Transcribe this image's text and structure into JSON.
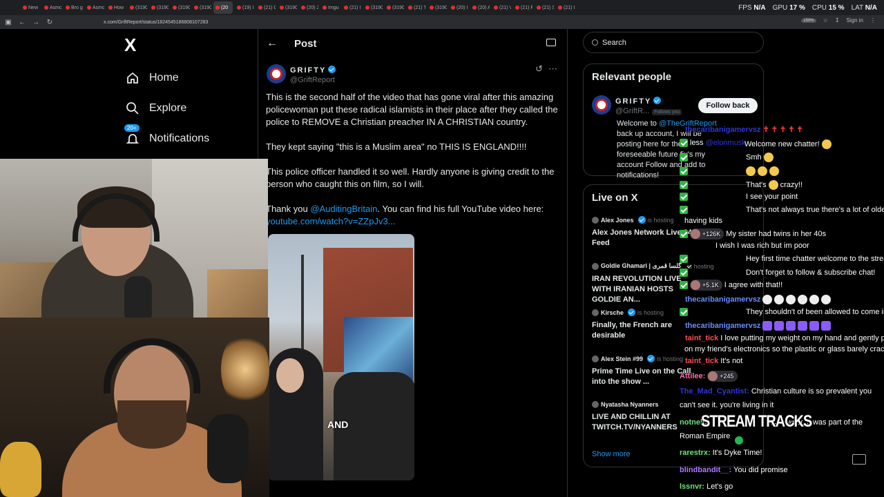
{
  "browser": {
    "tabs": [
      {
        "label": "New"
      },
      {
        "label": "Asmo"
      },
      {
        "label": "Bro g"
      },
      {
        "label": "Asmo"
      },
      {
        "label": "How"
      },
      {
        "label": "(3190"
      },
      {
        "label": "(3190"
      },
      {
        "label": "(3190"
      },
      {
        "label": "(3190"
      },
      {
        "label": "(20"
      },
      {
        "label": "(19) I"
      },
      {
        "label": "(21) C"
      },
      {
        "label": "(3190"
      },
      {
        "label": "(20) J"
      },
      {
        "label": "Imgu"
      },
      {
        "label": "(21) I"
      },
      {
        "label": "(3190"
      },
      {
        "label": "(3190"
      },
      {
        "label": "(21) T"
      },
      {
        "label": "(3190"
      },
      {
        "label": "(20) I"
      },
      {
        "label": "(20) A"
      },
      {
        "label": "(21) V"
      },
      {
        "label": "(21) F"
      },
      {
        "label": "(21) S"
      },
      {
        "label": "(21) I"
      }
    ],
    "perf": {
      "fps_label": "FPS",
      "fps_value": "N/A",
      "gpu_label": "GPU",
      "gpu_value": "17 %",
      "cpu_label": "CPU",
      "cpu_value": "15 %",
      "lat_label": "LAT",
      "lat_value": "N/A"
    },
    "url": "x.com/GriftReport/status/1824545186808107283",
    "zoom": "150%",
    "signin": "Sign in"
  },
  "xnav": {
    "logo": "X",
    "items": [
      {
        "label": "Home",
        "icon": "home-icon"
      },
      {
        "label": "Explore",
        "icon": "search-icon"
      },
      {
        "label": "Notifications",
        "icon": "bell-icon",
        "badge": "20+"
      }
    ]
  },
  "post": {
    "header_title": "Post",
    "author_name": "GRIFTY",
    "author_handle": "@GriftReport",
    "paragraphs": [
      "This is the second half of the video that has gone viral after this amazing policewoman put these radical islamists in their place after they called the police to REMOVE a Christian preacher IN A CHRISTIAN country.",
      "They kept saying \"this is a Muslim area\" no THIS IS ENGLAND!!!!",
      "This police officer handled it so well. Hardly anyone is giving credit to the person who caught this on film, so I will."
    ],
    "thanks_prefix": "Thank you ",
    "thanks_mention": "@AuditingBritain",
    "thanks_suffix": ". You can find his full YouTube video here:",
    "youtube_link": "youtube.com/watch?v=ZZpJv3...",
    "video_caption": "AND"
  },
  "sidebar": {
    "search_placeholder": "Search",
    "relevant_title": "Relevant people",
    "relevant_user": {
      "name": "GRIFTY",
      "handle": "@GriftR...",
      "follows_you": "Follows you",
      "follow_button": "Follow back",
      "bio_prefix": "Welcome to ",
      "bio_mention": "@TheGriftReport",
      "bio_rest": " back up account, I will be posting here for the foreseeable future",
      "bio_rest2": "fix's my account Follow and add to notifications!"
    },
    "live_title": "Live on X",
    "live_items": [
      {
        "host": "Alex Jones",
        "hosting": "is hosting",
        "title": "Alex Jones Network Live 24/7 Feed"
      },
      {
        "host": "Goldie Ghamari | گلسا قمری",
        "hosting": "is hosting",
        "title": "IRAN REVOLUTION LIVE WITH IRANIAN HOSTS GOLDIE AN..."
      },
      {
        "host": "Kirsche",
        "hosting": "is hosting",
        "title": "Finally, the French are desirable"
      },
      {
        "host": "Alex Stein #99",
        "hosting": "is hosting",
        "title": "Prime Time Live on the Call into the show ..."
      },
      {
        "host": "Nyatasha Nyanners",
        "hosting": "",
        "title": "LIVE AND CHILLIN AT TWITCH.TV/NYANNERS"
      }
    ],
    "show_more": "Show more"
  },
  "chat": {
    "messages": [
      {
        "user": "thecaribanigamervsz",
        "text": "",
        "color": "blue"
      },
      {
        "user": "",
        "text": "less",
        "mention": "@elonmusk",
        "color": "blue"
      },
      {
        "user": "",
        "text": "Welcome new chatter!",
        "color": "blue"
      },
      {
        "user": "",
        "text": "Smh",
        "color": "blue"
      },
      {
        "user": "",
        "text": "",
        "color": "blue"
      },
      {
        "user": "",
        "text": "That's",
        "text2": "crazy!!",
        "color": "blue"
      },
      {
        "user": "",
        "text": "I see your point",
        "color": "blue"
      },
      {
        "user": "",
        "text": "That's not always true there's a lot of olde",
        "color": "blue"
      },
      {
        "user": "",
        "text": "having kids",
        "color": "white"
      },
      {
        "user": "",
        "text": "My sister had twins in her 40s",
        "badge": "+126K",
        "color": "blue"
      },
      {
        "user": "",
        "text": "I wish I was rich but im poor",
        "color": "blue"
      },
      {
        "user": "",
        "text": "Hey first time chatter welcome to the strea",
        "color": "blue"
      },
      {
        "user": "",
        "text": "Don't forget to follow & subscribe chat!",
        "color": "blue"
      },
      {
        "user": "",
        "text": "I agree with that!!",
        "badge": "+5.1K",
        "color": "blue"
      },
      {
        "user": "thecaribanigamervsz",
        "text": "",
        "color": "lblue"
      },
      {
        "user": "",
        "text": "They shouldn't of been allowed to come in",
        "color": "blue"
      },
      {
        "user": "thecaribanigamervsz",
        "text": "",
        "badge": "+3.2K",
        "color": "lblue"
      },
      {
        "user": "taint_tick",
        "text": "I love putting my weight on my hand and gently p",
        "color": "red"
      },
      {
        "user": "",
        "text": "on my friend's electronics so the plastic or glass barely crac",
        "color": "white"
      },
      {
        "user": "taint_tick",
        "text": "It's not",
        "color": "red"
      },
      {
        "user": "Attilee:",
        "text": "",
        "badge": "+245",
        "color": "pink"
      },
      {
        "user": "The_Mad_Cyantist:",
        "text": "Christian culture is so prevalent you",
        "color": "blue"
      },
      {
        "user": "",
        "text": "can't see it. you're living in it",
        "color": "white"
      },
      {
        "user": "notnelo",
        "text": "in the west, it was part of the",
        "color": "green"
      },
      {
        "user": "",
        "text": "Roman Empire",
        "color": "white"
      },
      {
        "user": "rarestrx:",
        "text": "It's Dyke Time!",
        "color": "green"
      },
      {
        "user": "blindbandit__:",
        "text": "You did promise",
        "color": "purple"
      },
      {
        "user": "lssnvr:",
        "text": "Let's go",
        "color": "green"
      }
    ],
    "overlay_title": "STREAM TRACKS"
  }
}
